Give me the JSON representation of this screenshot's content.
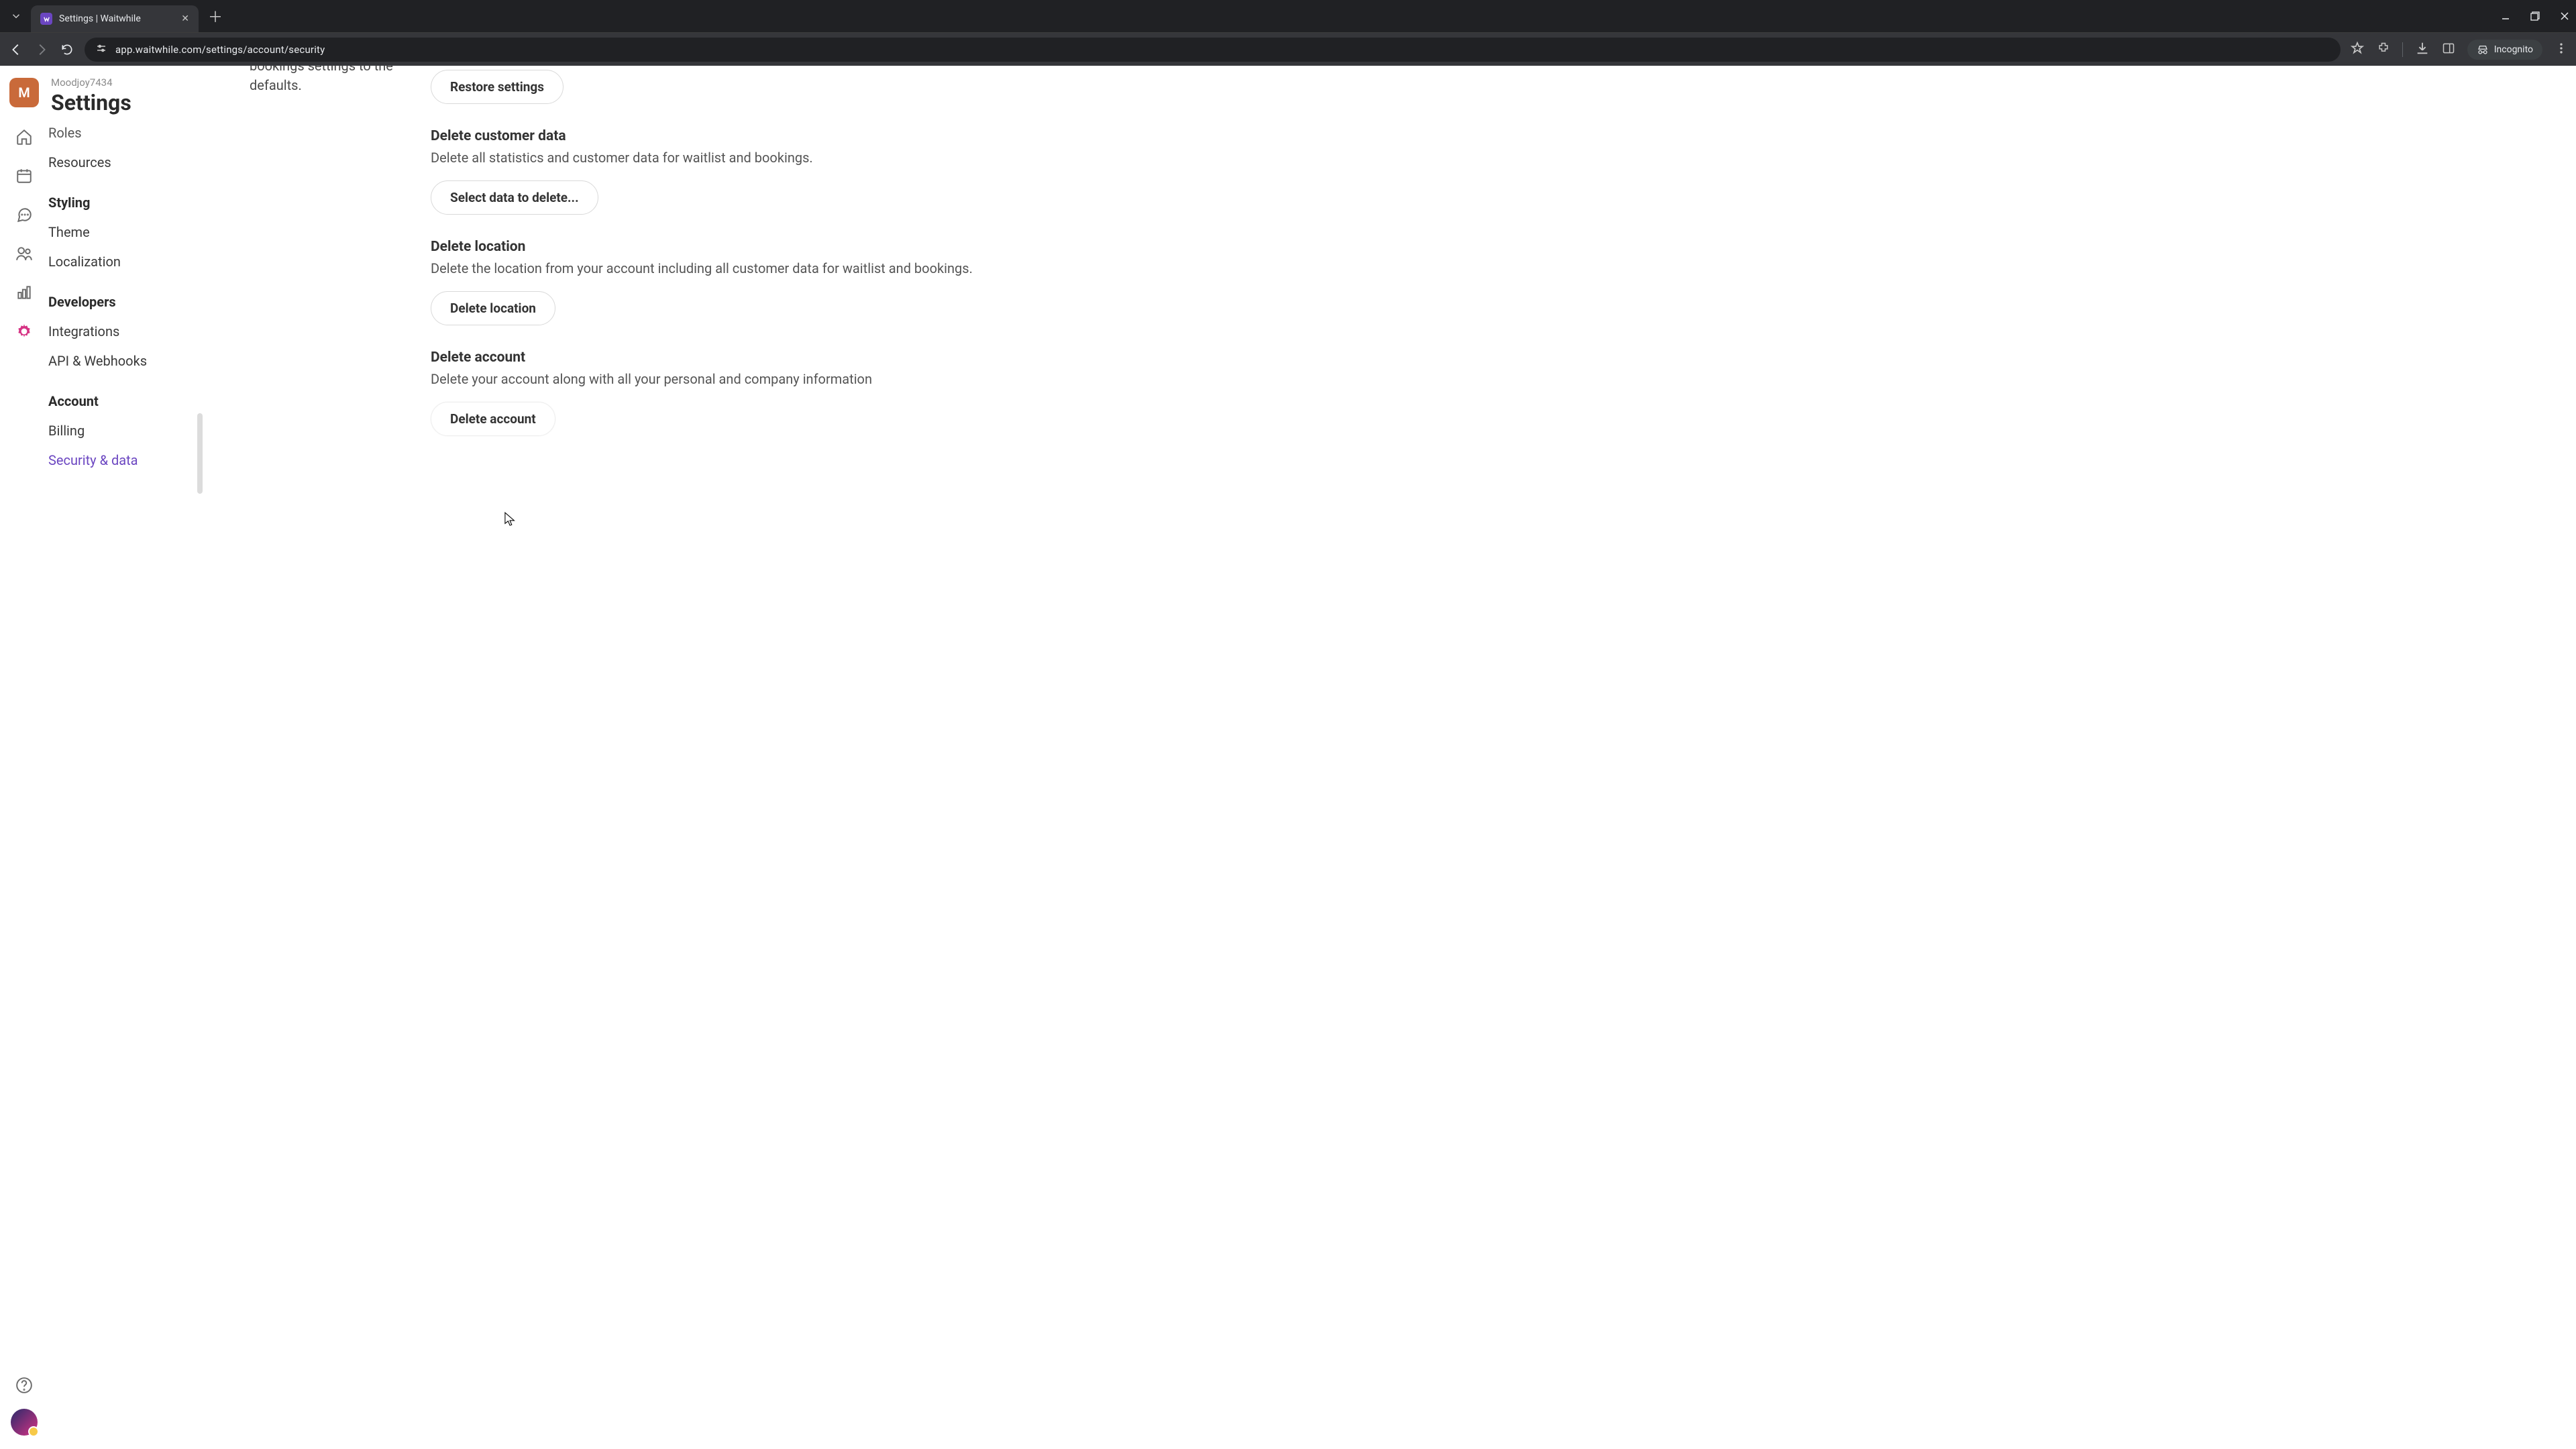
{
  "browser": {
    "tab_title": "Settings | Waitwhile",
    "url": "app.waitwhile.com/settings/account/security",
    "incognito_label": "Incognito"
  },
  "rail": {
    "avatar_letter": "M"
  },
  "header": {
    "workspace": "Moodjoy7434",
    "title": "Settings"
  },
  "sidebar": {
    "roles": "Roles",
    "resources": "Resources",
    "styling_heading": "Styling",
    "theme": "Theme",
    "localization": "Localization",
    "developers_heading": "Developers",
    "integrations": "Integrations",
    "api": "API & Webhooks",
    "account_heading": "Account",
    "billing": "Billing",
    "security": "Security & data"
  },
  "left_desc_partial": "bookings settings to the defaults.",
  "sections": {
    "restore_btn": "Restore settings",
    "del_customer": {
      "title": "Delete customer data",
      "desc": "Delete all statistics and customer data for waitlist and bookings.",
      "btn": "Select data to delete..."
    },
    "del_location": {
      "title": "Delete location",
      "desc": "Delete the location from your account including all customer data for waitlist and bookings.",
      "btn": "Delete location"
    },
    "del_account": {
      "title": "Delete account",
      "desc": "Delete your account along with all your personal and company information",
      "btn": "Delete account"
    }
  }
}
